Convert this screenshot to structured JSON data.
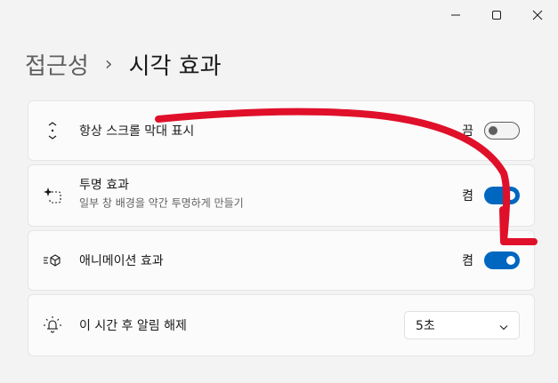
{
  "window": {
    "minimize_icon": "minimize-icon",
    "maximize_icon": "maximize-icon",
    "close_icon": "close-icon"
  },
  "breadcrumb": {
    "parent": "접근성",
    "separator": "›",
    "current": "시각 효과"
  },
  "settings": {
    "scrollbars": {
      "label": "항상 스크롤 막대 표시",
      "state": "끔",
      "on": false,
      "icon": "scrollbar-icon"
    },
    "transparency": {
      "label": "투명 효과",
      "description": "일부 창 배경을 약간 투명하게 만들기",
      "state": "켬",
      "on": true,
      "icon": "transparency-icon"
    },
    "animation": {
      "label": "애니메이션 효과",
      "state": "켬",
      "on": true,
      "icon": "animation-icon"
    },
    "dismiss": {
      "label": "이 시간 후 알림 해제",
      "value": "5초",
      "icon": "notification-timer-icon"
    }
  },
  "colors": {
    "accent": "#0067c0",
    "annotation": "#e0102a"
  }
}
